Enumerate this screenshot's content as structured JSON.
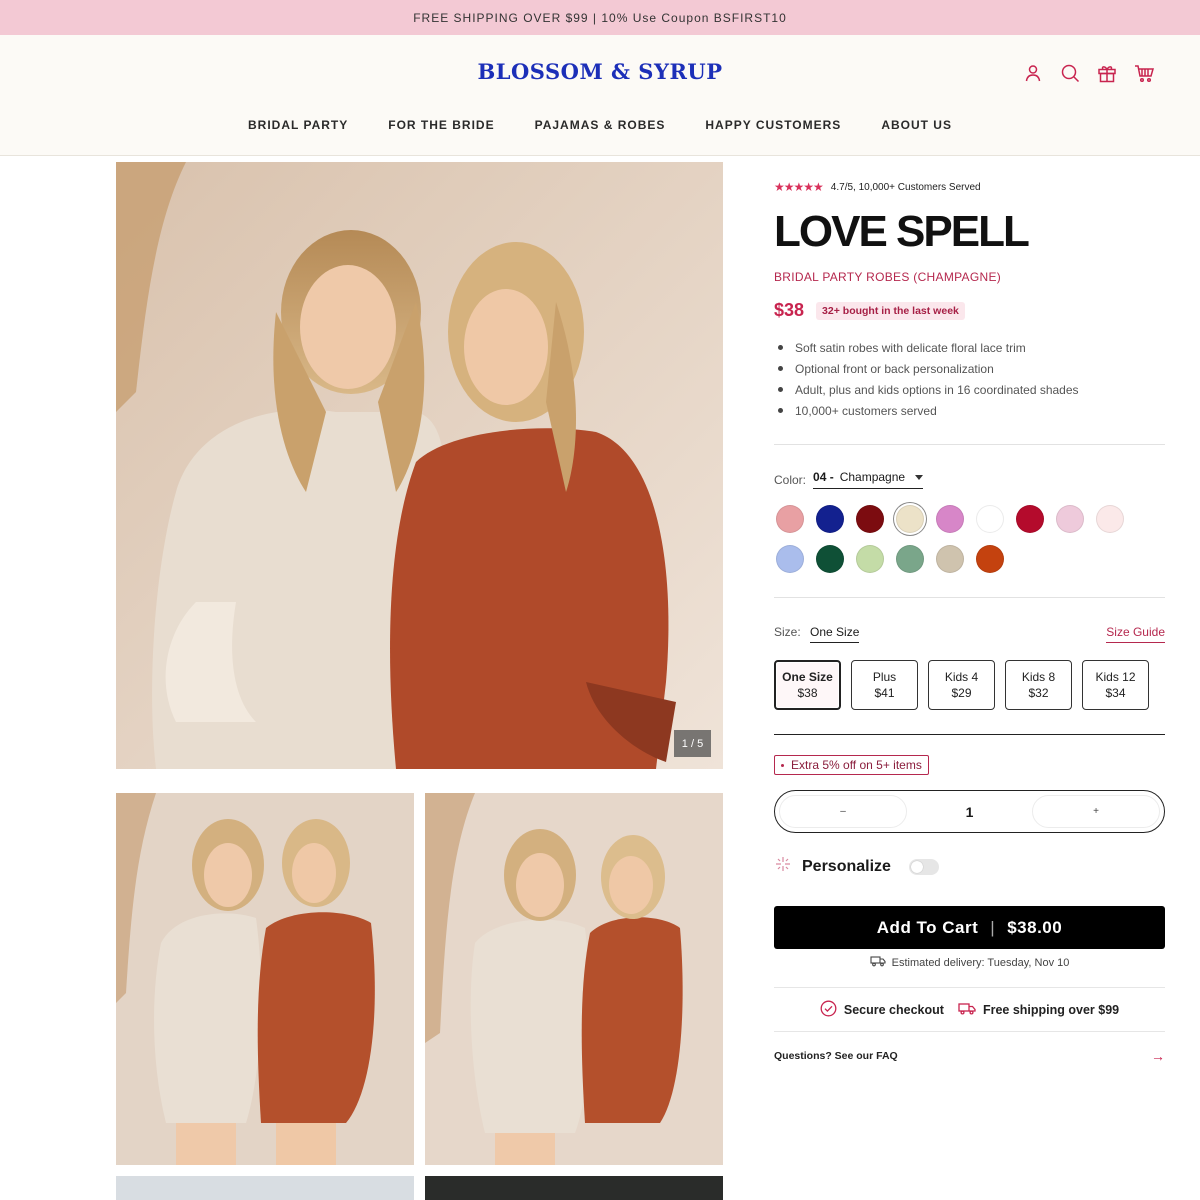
{
  "announcement": "FREE SHIPPING OVER $99 | 10% Use Coupon BSFIRST10",
  "brand": "BLOSSOM & SYRUP",
  "nav": [
    "BRIDAL PARTY",
    "FOR THE BRIDE",
    "PAJAMAS & ROBES",
    "HAPPY CUSTOMERS",
    "ABOUT US"
  ],
  "header_icons": [
    "account-icon",
    "search-icon",
    "gift-icon",
    "cart-icon"
  ],
  "gallery": {
    "counter": "1 / 5"
  },
  "product": {
    "rating_text": "4.7/5, 10,000+ Customers Served",
    "stars": "★★★★★",
    "title": "LOVE SPELL",
    "subtitle": "BRIDAL PARTY ROBES (CHAMPAGNE)",
    "price": "$38",
    "bought_badge": "32+ bought in the last week",
    "bullets": [
      "Soft satin robes with delicate floral lace trim",
      "Optional front or back personalization",
      "Adult, plus and kids options in 16 coordinated shades",
      "10,000+ customers served"
    ]
  },
  "color": {
    "label": "Color:",
    "code": "04 -",
    "name": "Champagne",
    "swatches": [
      "#e8a0a3",
      "#13218f",
      "#7c0c10",
      "#ece2c8",
      "#d786c8",
      "#ffffff",
      "#b40b2c",
      "#eecadb",
      "#fbe9e9",
      "#aabdec",
      "#0f5036",
      "#c4dca7",
      "#7aa68a",
      "#cfc3ae",
      "#c4420f"
    ],
    "selected_index": 3
  },
  "size": {
    "label": "Size:",
    "value": "One Size",
    "guide": "Size Guide",
    "options": [
      {
        "name": "One Size",
        "price": "$38"
      },
      {
        "name": "Plus",
        "price": "$41"
      },
      {
        "name": "Kids 4",
        "price": "$29"
      },
      {
        "name": "Kids 8",
        "price": "$32"
      },
      {
        "name": "Kids 12",
        "price": "$34"
      }
    ]
  },
  "promo": "Extra 5% off on 5+ items",
  "quantity": {
    "minus": "–",
    "value": "1",
    "plus": "+"
  },
  "personalize": {
    "label": "Personalize",
    "enabled": false
  },
  "cart": {
    "label": "Add To Cart",
    "separator": "|",
    "total": "$38.00"
  },
  "delivery": "Estimated delivery: Tuesday, Nov 10",
  "trust": {
    "secure": "Secure checkout",
    "shipping": "Free shipping over $99"
  },
  "faq": {
    "label": "Questions? See our FAQ",
    "arrow": "→"
  }
}
